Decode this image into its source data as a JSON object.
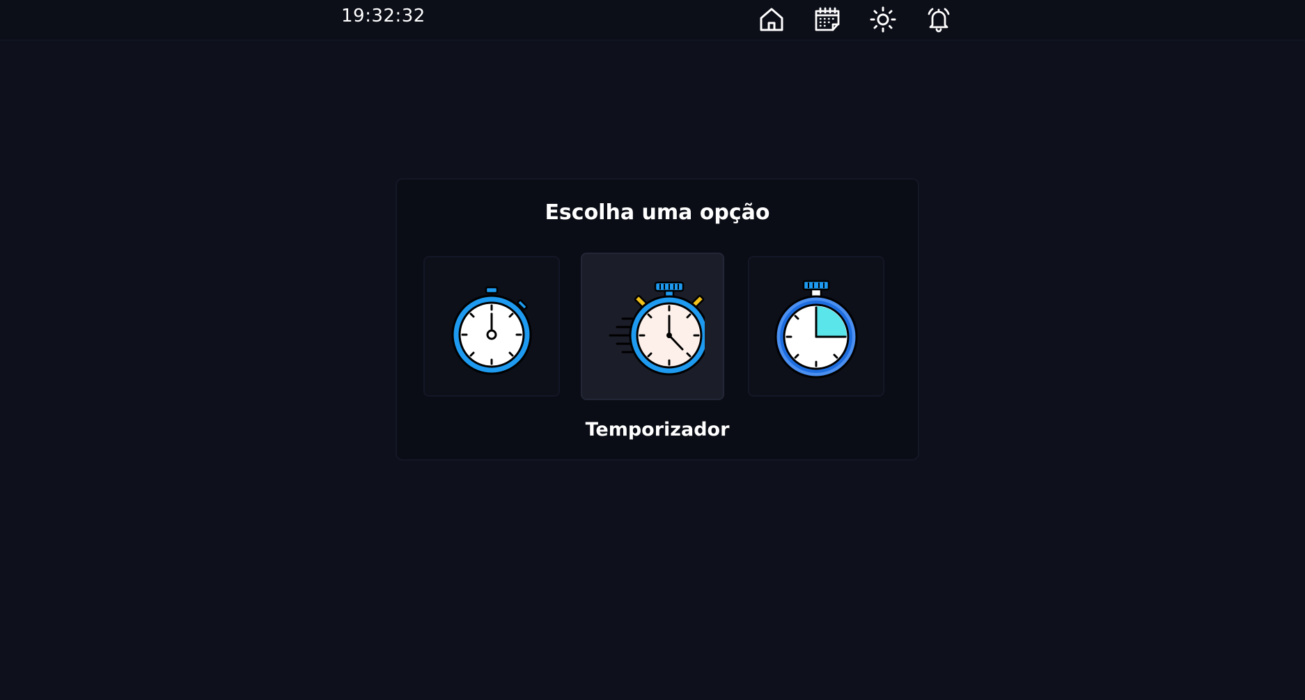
{
  "header": {
    "time": "19:32:32",
    "icons": [
      "home-icon",
      "calendar-icon",
      "brightness-icon",
      "alarm-bell-icon"
    ]
  },
  "panel": {
    "title": "Escolha uma opção",
    "options": [
      {
        "icon": "stopwatch-icon",
        "selected": false
      },
      {
        "icon": "fast-stopwatch-icon",
        "selected": true
      },
      {
        "icon": "timer-clock-icon",
        "selected": false
      }
    ],
    "selected_label": "Temporizador"
  },
  "colors": {
    "background": "#0e101c",
    "topbar": "#0c0e18",
    "panel": "#0b0d16",
    "selected_card": "#1b1d29",
    "accent_blue": "#1e9bf0",
    "accent_yellow": "#f2c21b",
    "accent_cyan": "#3de0e8"
  }
}
